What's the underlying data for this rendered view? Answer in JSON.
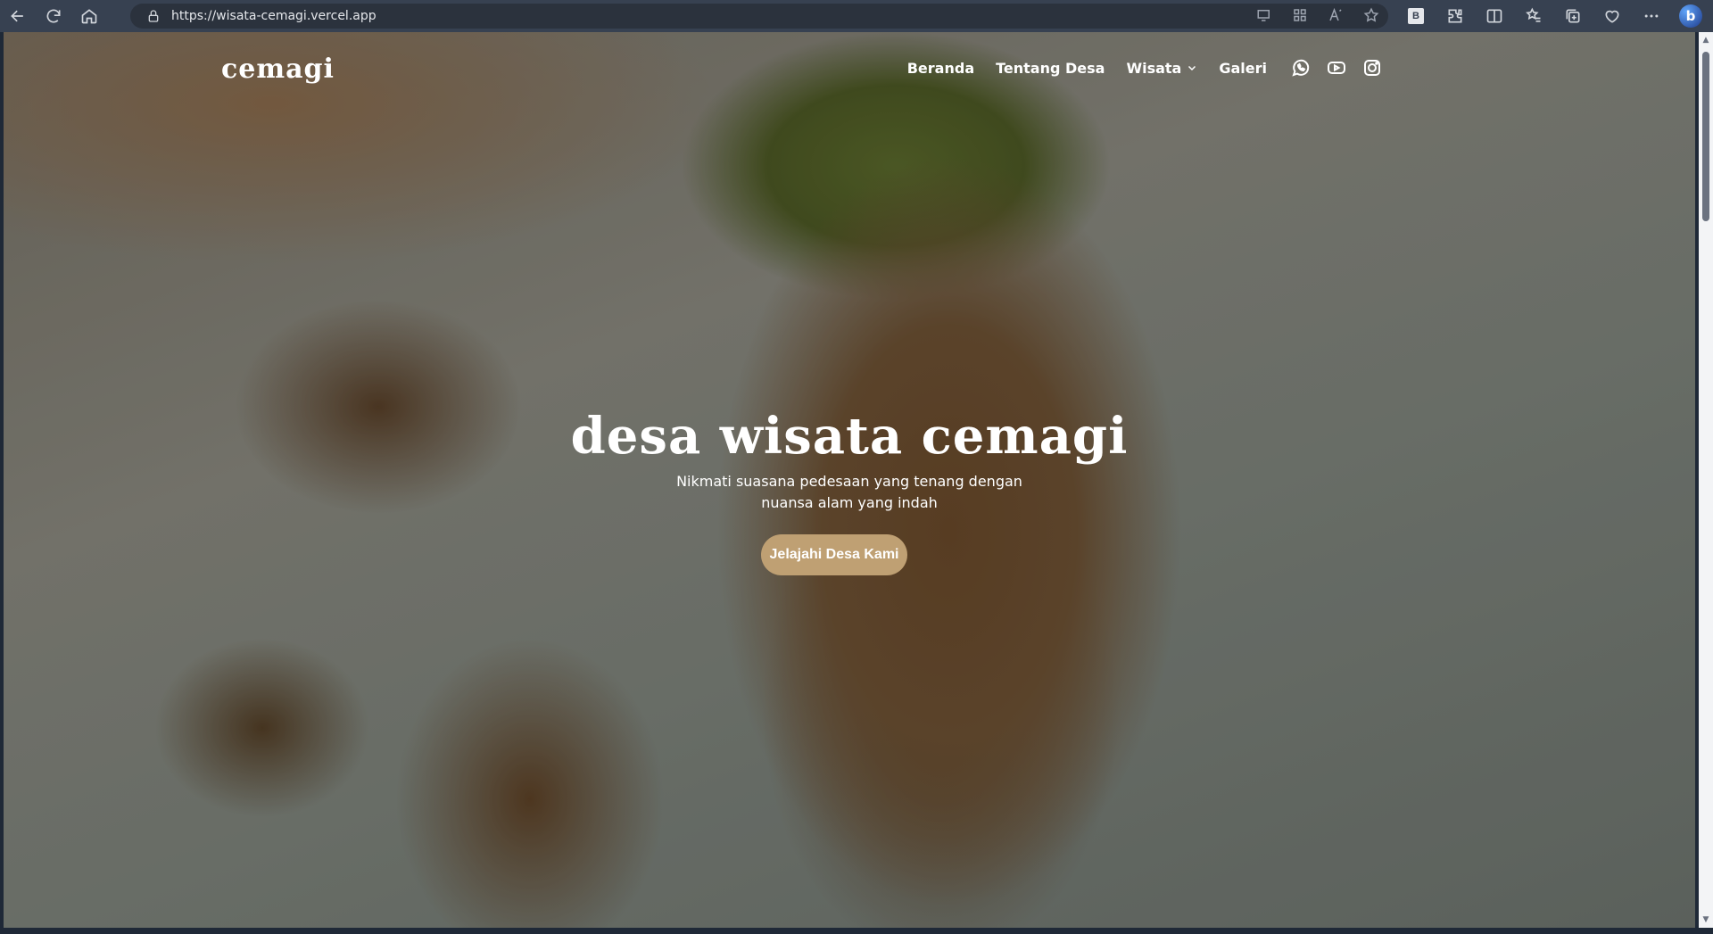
{
  "browser": {
    "url": "https://wisata-cemagi.vercel.app",
    "extension_label": "B",
    "copilot_label": "b"
  },
  "site": {
    "logo": "cemagi",
    "nav": {
      "home": "Beranda",
      "about": "Tentang Desa",
      "tourism": "Wisata",
      "gallery": "Galeri"
    },
    "socials": [
      "whatsapp-icon",
      "youtube-icon",
      "instagram-icon"
    ]
  },
  "hero": {
    "title": "desa wisata cemagi",
    "subtitle_line1": "Nikmati suasana pedesaan yang tenang dengan",
    "subtitle_line2": "nuansa alam yang indah",
    "cta": "Jelajahi Desa Kami"
  },
  "colors": {
    "accent": "#bfa073",
    "chrome": "#374151",
    "text": "#ffffff"
  }
}
